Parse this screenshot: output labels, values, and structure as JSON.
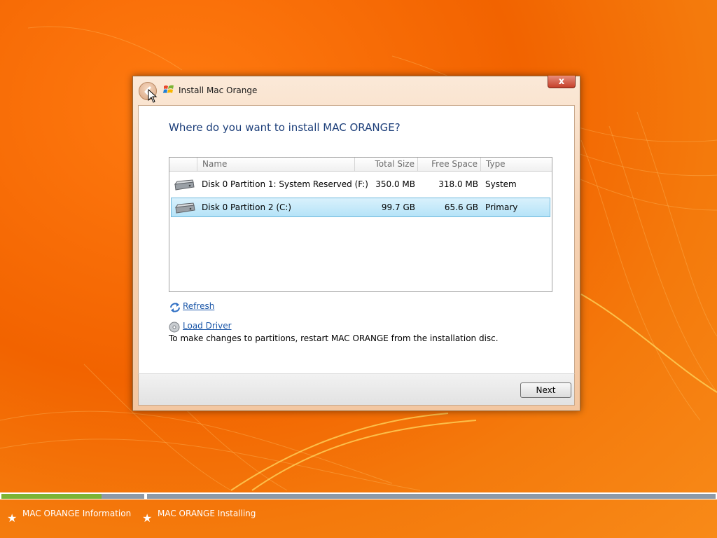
{
  "window": {
    "title": "Install Mac Orange",
    "close_label": "x"
  },
  "content": {
    "heading": "Where do you want to install MAC ORANGE?",
    "table": {
      "columns": [
        "Name",
        "Total Size",
        "Free Space",
        "Type"
      ],
      "rows": [
        {
          "name": "Disk 0 Partition 1: System Reserved (F:)",
          "total": "350.0 MB",
          "free": "318.0 MB",
          "type": "System",
          "selected": false
        },
        {
          "name": "Disk 0 Partition 2 (C:)",
          "total": "99.7 GB",
          "free": "65.6 GB",
          "type": "Primary",
          "selected": true
        }
      ]
    },
    "refresh_label": "Refresh",
    "load_driver_label": "Load Driver",
    "note": "To make changes to partitions, restart MAC ORANGE from the installation disc."
  },
  "footer": {
    "next_label": "Next"
  },
  "progress": {
    "steps": [
      "MAC ORANGE Information",
      "MAC ORANGE Installing"
    ],
    "step1_fraction": 0.7
  },
  "colors": {
    "background": "#f26300",
    "heading": "#1d3f7a",
    "link": "#1a56a8",
    "progress_fill": "#7cb435"
  }
}
